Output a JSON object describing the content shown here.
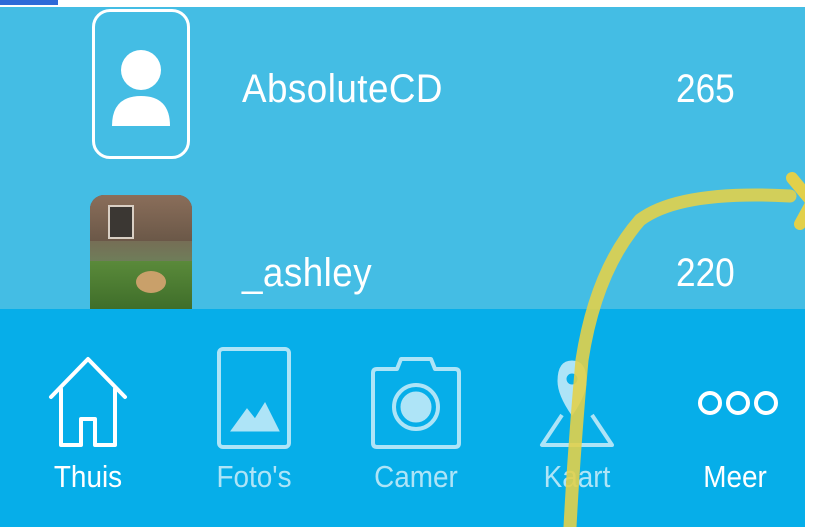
{
  "leaderboard": {
    "rows": [
      {
        "username": "AbsoluteCD",
        "score": "265",
        "avatar": "default-user-icon"
      },
      {
        "username": "_ashley",
        "score": "220",
        "avatar": "user-photo"
      }
    ]
  },
  "tab_bar": {
    "tabs": [
      {
        "label": "Thuis",
        "icon": "home-icon",
        "active": true
      },
      {
        "label": "Foto's",
        "icon": "photo-icon",
        "active": false
      },
      {
        "label": "Camer",
        "icon": "camera-icon",
        "active": false
      },
      {
        "label": "Kaart",
        "icon": "map-pin-icon",
        "active": false
      },
      {
        "label": "Meer",
        "icon": "more-icon",
        "active": true
      }
    ]
  },
  "colors": {
    "list_background": "#44bde4",
    "tab_bar_background": "#06aee9",
    "annotation_stroke": "#e2d04a",
    "top_accent": "#2f6ad8"
  }
}
